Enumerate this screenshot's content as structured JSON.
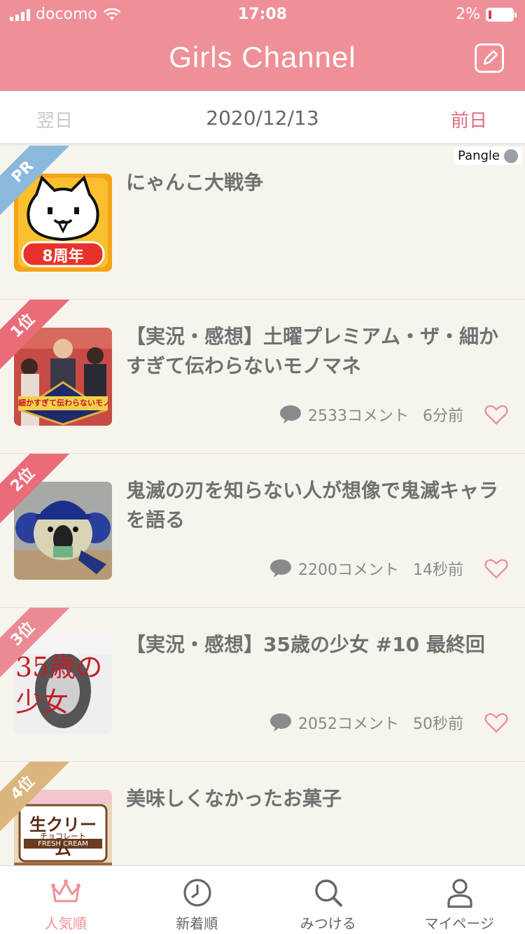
{
  "status_bar": {
    "carrier": "docomo",
    "time": "17:08",
    "battery": "2%"
  },
  "header": {
    "title": "Girls Channel",
    "compose_icon": "compose-icon"
  },
  "date_nav": {
    "next_label": "翌日",
    "date": "2020/12/13",
    "prev_label": "前日"
  },
  "ad": {
    "badge": "PR",
    "title": "にゃんこ大戦争",
    "provider": "Pangle",
    "thumb_caption": "8周年"
  },
  "topics": [
    {
      "rank": "1位",
      "title": "【実況・感想】土曜プレミアム・ザ・細かすぎて伝わらないモノマネ",
      "comments": "2533コメント",
      "ago": "6分前"
    },
    {
      "rank": "2位",
      "title": "鬼滅の刃を知らない人が想像で鬼滅キャラを語る",
      "comments": "2200コメント",
      "ago": "14秒前"
    },
    {
      "rank": "3位",
      "title": "【実況・感想】35歳の少女 #10 最終回",
      "comments": "2052コメント",
      "ago": "50秒前"
    },
    {
      "rank": "4位",
      "title": "美味しくなかったお菓子",
      "thumb_text": "生クリーム",
      "thumb_sub": "チョコレート",
      "thumb_en": "FRESH CREAM"
    }
  ],
  "thumb_texts": {
    "t1": "細かすぎて伝わらないモノマネ",
    "t3": "35歳の少女"
  },
  "tabs": [
    {
      "label": "人気順",
      "icon": "crown-icon",
      "active": true
    },
    {
      "label": "新着順",
      "icon": "clock-icon",
      "active": false
    },
    {
      "label": "みつける",
      "icon": "search-icon",
      "active": false
    },
    {
      "label": "マイページ",
      "icon": "user-icon",
      "active": false
    }
  ],
  "colors": {
    "accent": "#ef8f98",
    "rank1": "#ea6c79",
    "rank2": "#ea6c79",
    "rank3": "#ec8a93",
    "rank4": "#dcb47d",
    "pr": "#8bb9dc"
  }
}
